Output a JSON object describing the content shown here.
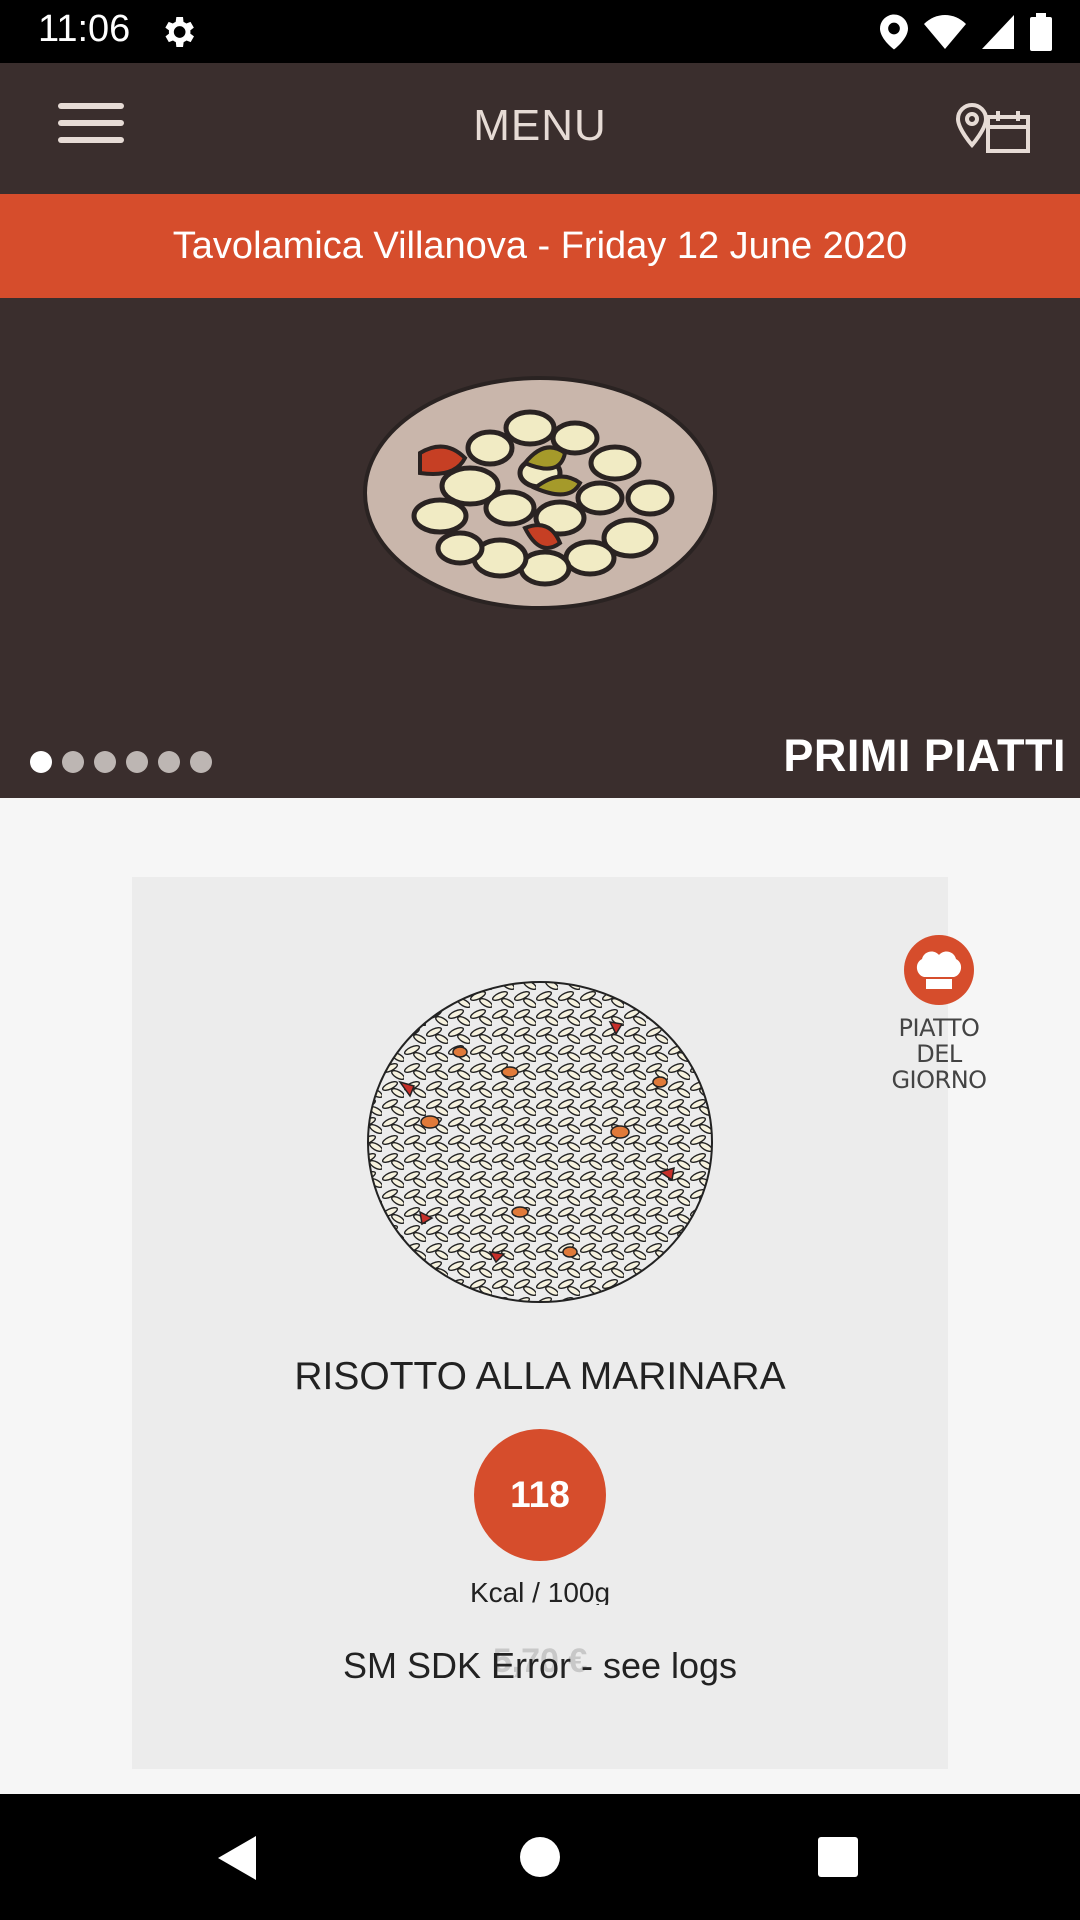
{
  "status_bar": {
    "time": "11:06",
    "icons": [
      "settings-gear-icon",
      "location-icon",
      "wifi-icon",
      "signal-icon",
      "battery-icon"
    ]
  },
  "app_bar": {
    "title": "MENU",
    "left_icon": "hamburger-menu-icon",
    "right_icon": "location-calendar-icon"
  },
  "banner": {
    "text": "Tavolamica Villanova - Friday 12 June 2020"
  },
  "hero": {
    "category": "PRIMI PIATTI",
    "image": "pasta-plate-illustration",
    "pager": {
      "count": 6,
      "active_index": 0
    }
  },
  "dish_card": {
    "image": "risotto-illustration",
    "badge_label": "PIATTO DEL GIORNO",
    "badge_icon": "chef-hat-icon",
    "name": "RISOTTO ALLA MARINARA",
    "kcal_value": "118",
    "kcal_unit": "Kcal / 100g",
    "price": "5,70 €",
    "error_text": "SM SDK Error - see logs"
  },
  "nav_bar": {
    "icons": [
      "back-icon",
      "home-icon",
      "recents-icon"
    ]
  },
  "colors": {
    "accent": "#d64d2c",
    "dark_brown": "#3a2e2d",
    "card_bg": "#ececec",
    "page_bg": "#f6f6f6"
  }
}
